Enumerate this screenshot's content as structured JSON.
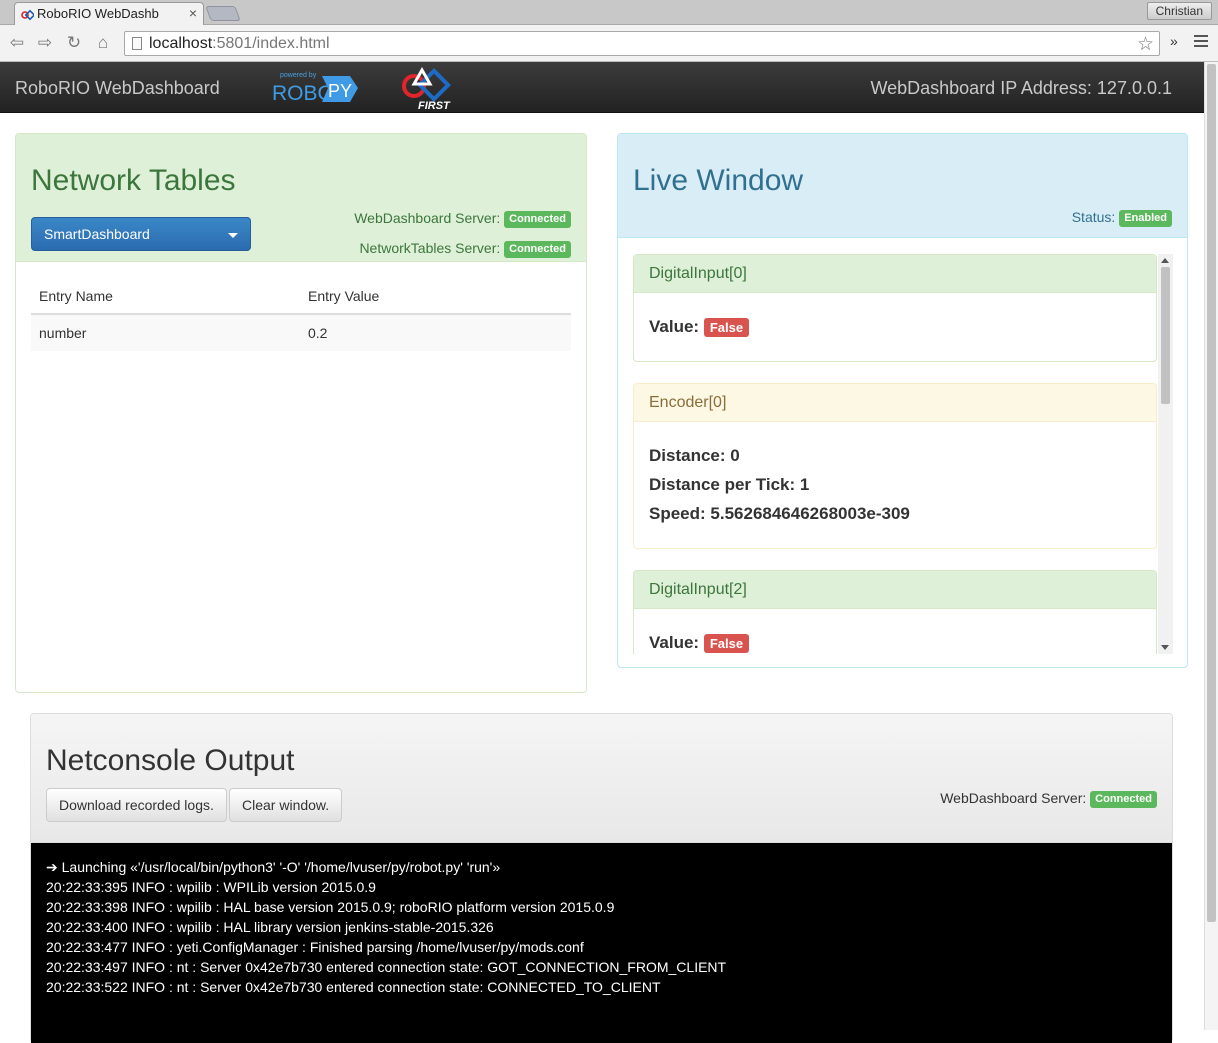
{
  "browser": {
    "tab_title": "RoboRIO WebDashb",
    "user": "Christian",
    "url_host": "localhost",
    "url_rest": ":5801/index.html",
    "more": "»"
  },
  "navbar": {
    "brand": "RoboRIO WebDashboard",
    "ip_label": "WebDashboard IP Address: 127.0.0.1",
    "robotpy_powered": "powered by",
    "robotpy_text": "ROBOT",
    "robotpy_py": "PY",
    "first_text": "FIRST"
  },
  "network_tables": {
    "title": "Network Tables",
    "dropdown_value": "SmartDashboard",
    "webdash_label": "WebDashboard Server:",
    "webdash_status": "Connected",
    "nt_label": "NetworkTables Server:",
    "nt_status": "Connected",
    "columns": [
      "Entry Name",
      "Entry Value"
    ],
    "rows": [
      {
        "name": "number",
        "value": "0.2"
      }
    ]
  },
  "live_window": {
    "title": "Live Window",
    "status_label": "Status:",
    "status_value": "Enabled",
    "cards": [
      {
        "title": "DigitalInput[0]",
        "value_label": "Value:",
        "value": "False"
      },
      {
        "title": "Encoder[0]",
        "distance": "Distance: 0",
        "dpt": "Distance per Tick: 1",
        "speed": "Speed: 5.562684646268003e-309"
      },
      {
        "title": "DigitalInput[2]",
        "value_label": "Value:",
        "value": "False"
      }
    ]
  },
  "netconsole": {
    "title": "Netconsole Output",
    "download_label": "Download recorded logs.",
    "clear_label": "Clear window.",
    "server_label": "WebDashboard Server:",
    "server_status": "Connected",
    "lines": [
      "➔ Launching «'/usr/local/bin/python3' '-O' '/home/lvuser/py/robot.py' 'run'»",
      "20:22:33:395 INFO : wpilib : WPILib version 2015.0.9",
      "20:22:33:398 INFO : wpilib : HAL base version 2015.0.9; roboRIO platform version 2015.0.9",
      "20:22:33:400 INFO : wpilib : HAL library version jenkins-stable-2015.326",
      "20:22:33:477 INFO : yeti.ConfigManager : Finished parsing /home/lvuser/py/mods.conf",
      "20:22:33:497 INFO : nt : Server 0x42e7b730 entered connection state: GOT_CONNECTION_FROM_CLIENT",
      "20:22:33:522 INFO : nt : Server 0x42e7b730 entered connection state: CONNECTED_TO_CLIENT"
    ]
  }
}
